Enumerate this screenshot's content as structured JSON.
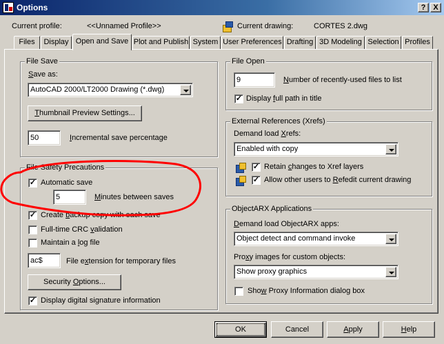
{
  "window": {
    "title": "Options",
    "help_button": "?",
    "close_button": "X"
  },
  "header": {
    "profile_label": "Current profile:",
    "profile_value": "<<Unnamed Profile>>",
    "drawing_label": "Current drawing:",
    "drawing_value": "CORTES 2.dwg"
  },
  "tabs": [
    {
      "label": "Files",
      "active": false
    },
    {
      "label": "Display",
      "active": false
    },
    {
      "label": "Open and Save",
      "active": true
    },
    {
      "label": "Plot and Publish",
      "active": false
    },
    {
      "label": "System",
      "active": false
    },
    {
      "label": "User Preferences",
      "active": false
    },
    {
      "label": "Drafting",
      "active": false
    },
    {
      "label": "3D Modeling",
      "active": false
    },
    {
      "label": "Selection",
      "active": false
    },
    {
      "label": "Profiles",
      "active": false
    }
  ],
  "file_save": {
    "legend": "File Save",
    "save_as_label": "Save as:",
    "save_as_value": "AutoCAD 2000/LT2000 Drawing (*.dwg)",
    "thumbnail_button": "Thumbnail Preview Settings...",
    "incremental_value": "50",
    "incremental_label": "Incremental save percentage"
  },
  "file_safety": {
    "legend": "File Safety Precautions",
    "automatic_save_label": "Automatic save",
    "automatic_save_checked": true,
    "minutes_value": "5",
    "minutes_label": "Minutes between saves",
    "backup_label": "Create backup copy with each save",
    "backup_checked": true,
    "crc_label": "Full-time CRC validation",
    "crc_checked": false,
    "log_label": "Maintain a log file",
    "log_checked": false,
    "ext_value": "ac$",
    "ext_label": "File extension for temporary files",
    "security_button": "Security Options...",
    "signature_label": "Display digital signature information",
    "signature_checked": true
  },
  "file_open": {
    "legend": "File Open",
    "recent_value": "9",
    "recent_label": "Number of recently-used files to list",
    "fullpath_label": "Display full path in title",
    "fullpath_checked": true
  },
  "xrefs": {
    "legend": "External References (Xrefs)",
    "demand_label": "Demand load Xrefs:",
    "demand_value": "Enabled with copy",
    "retain_label": "Retain changes to Xref layers",
    "retain_checked": true,
    "refedit_label": "Allow other users to Refedit current drawing",
    "refedit_checked": true
  },
  "objectarx": {
    "legend": "ObjectARX Applications",
    "demand_label": "Demand load ObjectARX apps:",
    "demand_value": "Object detect and command invoke",
    "proxy_label": "Proxy images for custom objects:",
    "proxy_value": "Show proxy graphics",
    "show_proxy_label": "Show Proxy Information dialog box",
    "show_proxy_checked": false
  },
  "footer": {
    "ok": "OK",
    "cancel": "Cancel",
    "apply": "Apply",
    "help": "Help"
  },
  "annotation": {
    "color": "#ff0000"
  }
}
